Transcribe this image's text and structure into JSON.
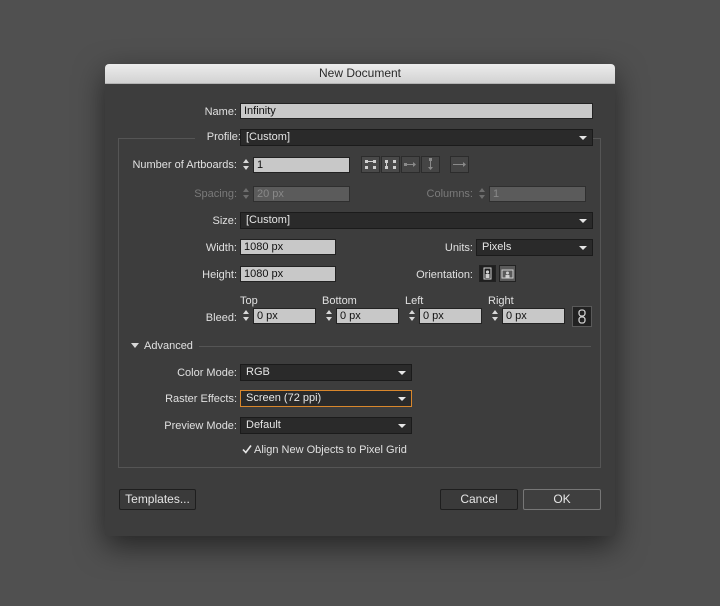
{
  "dialog": {
    "title": "New Document",
    "name_label": "Name:",
    "name_value": "Infinity",
    "profile_label": "Profile:",
    "profile_value": "[Custom]",
    "artboards_label": "Number of Artboards:",
    "artboards_value": "1",
    "spacing_label": "Spacing:",
    "spacing_value": "20 px",
    "columns_label": "Columns:",
    "columns_value": "1",
    "size_label": "Size:",
    "size_value": "[Custom]",
    "width_label": "Width:",
    "width_value": "1080 px",
    "units_label": "Units:",
    "units_value": "Pixels",
    "height_label": "Height:",
    "height_value": "1080 px",
    "orientation_label": "Orientation:",
    "bleed_label": "Bleed:",
    "bleed": {
      "top_label": "Top",
      "top_value": "0 px",
      "bottom_label": "Bottom",
      "bottom_value": "0 px",
      "left_label": "Left",
      "left_value": "0 px",
      "right_label": "Right",
      "right_value": "0 px"
    },
    "advanced_label": "Advanced",
    "color_mode_label": "Color Mode:",
    "color_mode_value": "RGB",
    "raster_label": "Raster Effects:",
    "raster_value": "Screen (72 ppi)",
    "preview_label": "Preview Mode:",
    "preview_value": "Default",
    "align_label": "Align New Objects to Pixel Grid",
    "align_checked": true,
    "templates_label": "Templates...",
    "cancel_label": "Cancel",
    "ok_label": "OK"
  },
  "colors": {
    "desktop": "#505050",
    "dialog_bg": "#3d3d3d",
    "focus_accent": "#d9872c"
  },
  "icons": [
    "grid-by-row-icon",
    "grid-by-column-icon",
    "arrange-by-row-icon",
    "arrange-by-column-icon",
    "right-to-left-arrow-icon",
    "portrait-icon",
    "landscape-icon",
    "link-bleed-icon",
    "checkmark-icon",
    "disclosure-triangle-icon"
  ]
}
